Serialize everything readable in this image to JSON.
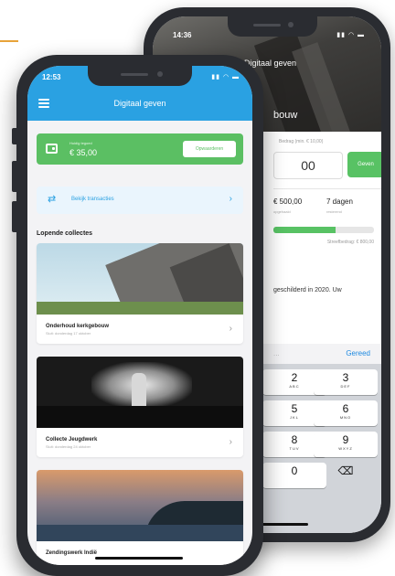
{
  "back_phone": {
    "status_time": "14:36",
    "status_icons": "▮▮ ◠ ▬",
    "title": "Digitaal geven",
    "hero_title": "bouw",
    "amount_label": "Bedrag (min. € 10,00)",
    "amount_value": "00",
    "give_button": "Geven",
    "stat_amount": "€ 500,00",
    "stat_amount_sub": "opgehaald",
    "stat_days": "7 dagen",
    "stat_days_sub": "resterend",
    "progress_fraction": 0.62,
    "goal_text": "Streefbedrag: € 800,00",
    "description": "geschilderd in 2020. Uw",
    "keyboard_done": "Gereed",
    "keyboard_left": "..."
  },
  "keypad": [
    {
      "digit": "2",
      "letters": "ABC"
    },
    {
      "digit": "3",
      "letters": "DEF"
    },
    {
      "digit": "5",
      "letters": "JKL"
    },
    {
      "digit": "6",
      "letters": "MNO"
    },
    {
      "digit": "8",
      "letters": "TUV"
    },
    {
      "digit": "9",
      "letters": "WXYZ"
    },
    {
      "digit": "0",
      "letters": ""
    },
    {
      "digit": "⌫",
      "letters": ""
    }
  ],
  "front_phone": {
    "status_time": "12:53",
    "status_icons": "▮▮ ◠ ▬",
    "header_title": "Digitaal geven",
    "balance_label": "Huidig tegoed",
    "balance_value": "€ 35,00",
    "topup_button": "Opwaarderen",
    "transactions_label": "Bekijk transacties",
    "section_title": "Lopende collectes",
    "collections": [
      {
        "title": "Onderhoud kerkgebouw",
        "subtitle": "Sluit: donderdag 17 oktober"
      },
      {
        "title": "Collecte Jeugdwerk",
        "subtitle": "Sluit: donderdag 24 oktober"
      },
      {
        "title": "Zendingswerk Indië",
        "subtitle": ""
      }
    ]
  },
  "colors": {
    "header_blue": "#2aa1e2",
    "green": "#5bbf63",
    "accent_orange": "#e8a33a"
  }
}
